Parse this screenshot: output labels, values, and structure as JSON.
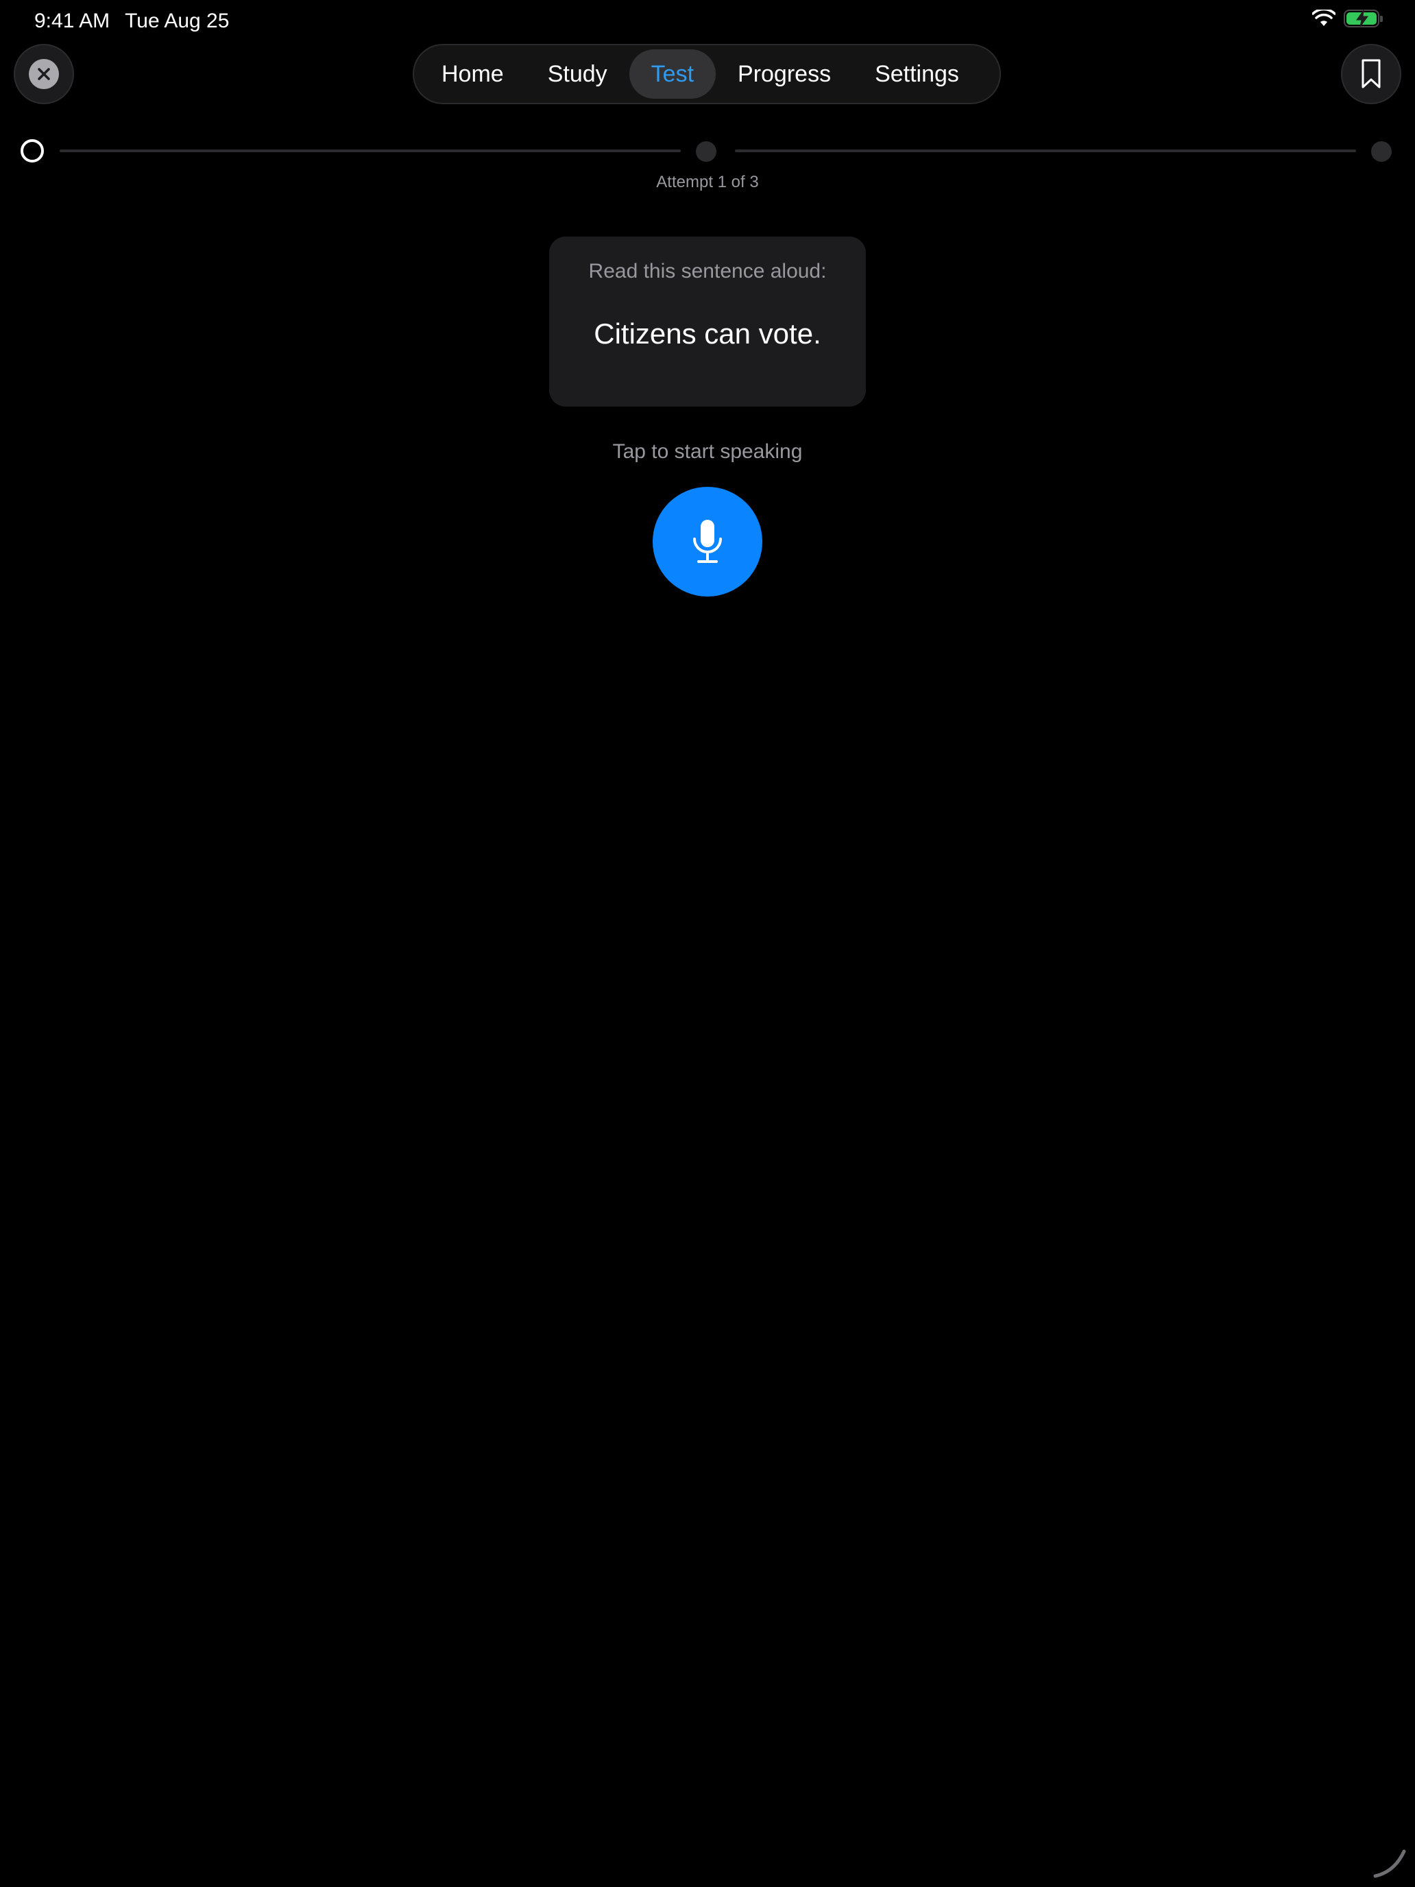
{
  "status_bar": {
    "time": "9:41 AM",
    "date": "Tue Aug 25",
    "wifi_icon": "wifi-icon",
    "battery_icon": "battery-charging-icon",
    "battery_color": "#34c759"
  },
  "nav": {
    "close_icon": "close-icon",
    "bookmark_icon": "bookmark-icon",
    "tabs": [
      {
        "label": "Home",
        "active": false
      },
      {
        "label": "Study",
        "active": false
      },
      {
        "label": "Test",
        "active": true
      },
      {
        "label": "Progress",
        "active": false
      },
      {
        "label": "Settings",
        "active": false
      }
    ],
    "active_color": "#2e9bf0"
  },
  "progress": {
    "steps_total": 3,
    "current_step": 1,
    "attempt_label": "Attempt 1 of 3"
  },
  "prompt": {
    "instruction": "Read this sentence aloud:",
    "sentence": "Citizens can vote."
  },
  "speak": {
    "hint": "Tap to start speaking",
    "mic_icon": "microphone-icon",
    "accent": "#0a84ff"
  }
}
